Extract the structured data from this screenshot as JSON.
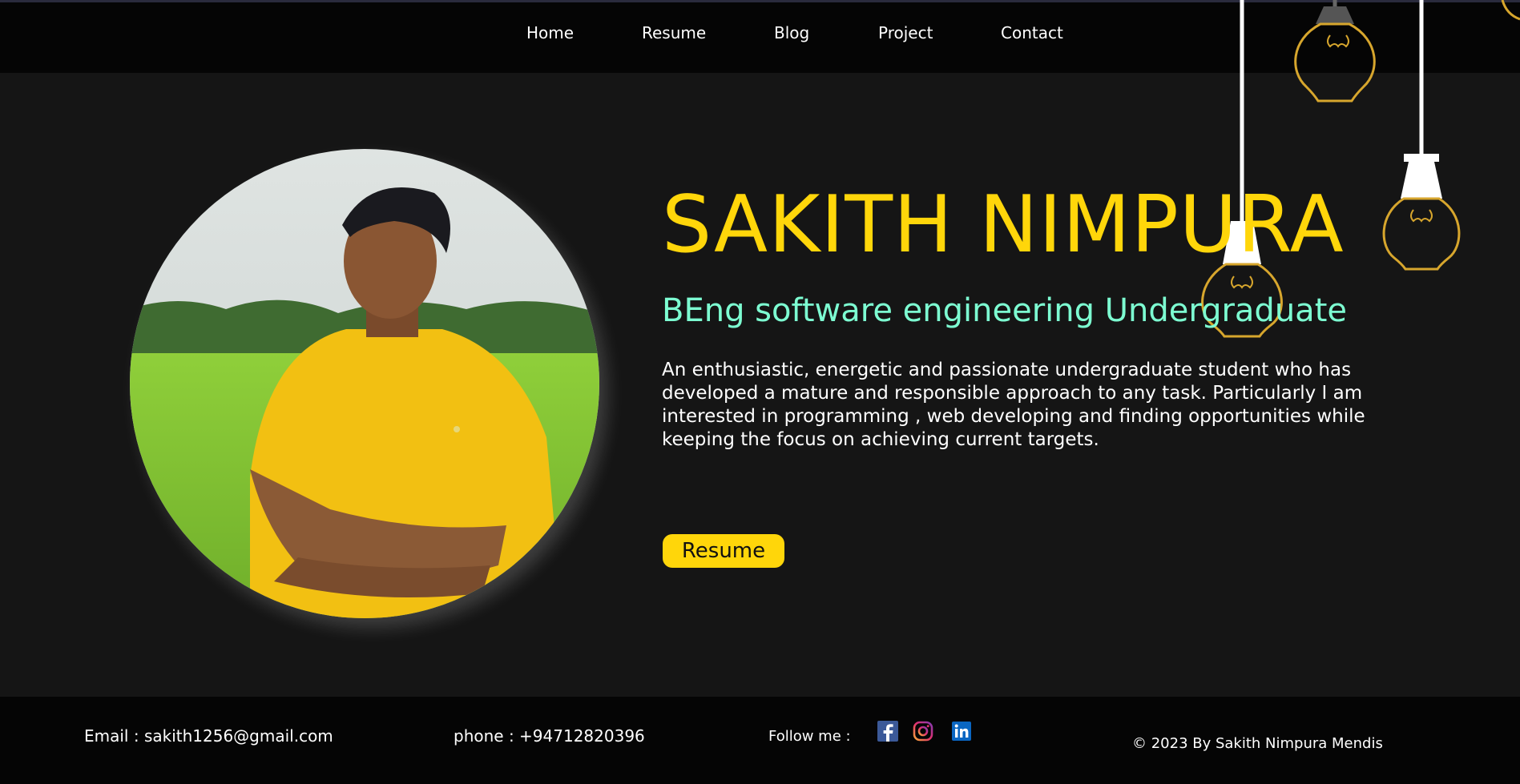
{
  "nav": {
    "items": [
      {
        "label": "Home"
      },
      {
        "label": "Resume"
      },
      {
        "label": "Blog"
      },
      {
        "label": "Project"
      },
      {
        "label": "Contact"
      }
    ]
  },
  "hero": {
    "name": "SAKITH NIMPURA",
    "subtitle": "BEng software engineering Undergraduate",
    "bio": "An enthusiastic, energetic and passionate undergraduate student who has developed a mature and responsible approach to any task. Particularly I am interested in programming , web developing and finding opportunities while keeping the focus on achieving current targets.",
    "button_label": "Resume"
  },
  "footer": {
    "email": "Email : sakith1256@gmail.com",
    "phone": "phone : +94712820396",
    "follow": "Follow me :",
    "copyright": "© 2023 By Sakith Nimpura Mendis",
    "social_icons": [
      "facebook-icon",
      "instagram-icon",
      "linkedin-icon"
    ]
  },
  "colors": {
    "accent_yellow": "#ffd60a",
    "subtitle_mint": "#7dffd2",
    "background": "#151515",
    "bar": "#050505"
  }
}
